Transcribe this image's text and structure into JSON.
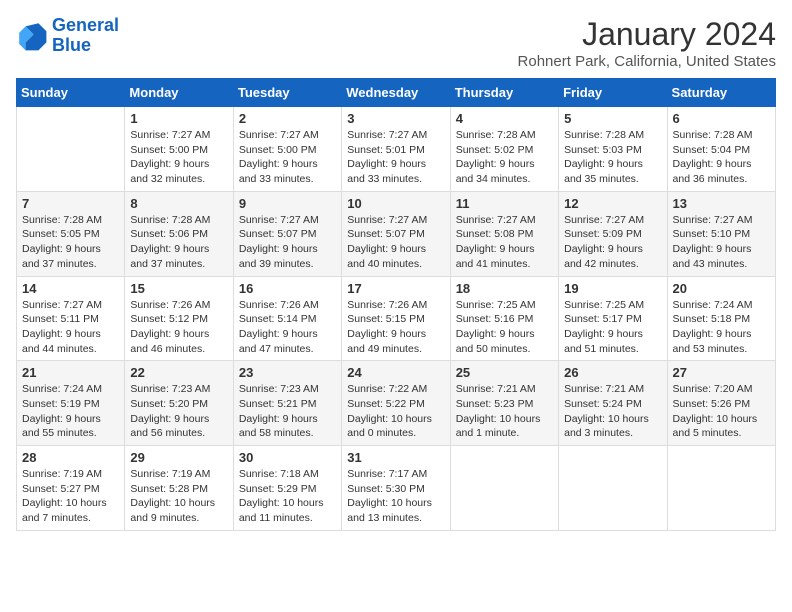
{
  "header": {
    "logo_line1": "General",
    "logo_line2": "Blue",
    "title": "January 2024",
    "subtitle": "Rohnert Park, California, United States"
  },
  "weekdays": [
    "Sunday",
    "Monday",
    "Tuesday",
    "Wednesday",
    "Thursday",
    "Friday",
    "Saturday"
  ],
  "weeks": [
    [
      {
        "day": "",
        "sunrise": "",
        "sunset": "",
        "daylight": ""
      },
      {
        "day": "1",
        "sunrise": "Sunrise: 7:27 AM",
        "sunset": "Sunset: 5:00 PM",
        "daylight": "Daylight: 9 hours and 32 minutes."
      },
      {
        "day": "2",
        "sunrise": "Sunrise: 7:27 AM",
        "sunset": "Sunset: 5:00 PM",
        "daylight": "Daylight: 9 hours and 33 minutes."
      },
      {
        "day": "3",
        "sunrise": "Sunrise: 7:27 AM",
        "sunset": "Sunset: 5:01 PM",
        "daylight": "Daylight: 9 hours and 33 minutes."
      },
      {
        "day": "4",
        "sunrise": "Sunrise: 7:28 AM",
        "sunset": "Sunset: 5:02 PM",
        "daylight": "Daylight: 9 hours and 34 minutes."
      },
      {
        "day": "5",
        "sunrise": "Sunrise: 7:28 AM",
        "sunset": "Sunset: 5:03 PM",
        "daylight": "Daylight: 9 hours and 35 minutes."
      },
      {
        "day": "6",
        "sunrise": "Sunrise: 7:28 AM",
        "sunset": "Sunset: 5:04 PM",
        "daylight": "Daylight: 9 hours and 36 minutes."
      }
    ],
    [
      {
        "day": "7",
        "sunrise": "Sunrise: 7:28 AM",
        "sunset": "Sunset: 5:05 PM",
        "daylight": "Daylight: 9 hours and 37 minutes."
      },
      {
        "day": "8",
        "sunrise": "Sunrise: 7:28 AM",
        "sunset": "Sunset: 5:06 PM",
        "daylight": "Daylight: 9 hours and 37 minutes."
      },
      {
        "day": "9",
        "sunrise": "Sunrise: 7:27 AM",
        "sunset": "Sunset: 5:07 PM",
        "daylight": "Daylight: 9 hours and 39 minutes."
      },
      {
        "day": "10",
        "sunrise": "Sunrise: 7:27 AM",
        "sunset": "Sunset: 5:07 PM",
        "daylight": "Daylight: 9 hours and 40 minutes."
      },
      {
        "day": "11",
        "sunrise": "Sunrise: 7:27 AM",
        "sunset": "Sunset: 5:08 PM",
        "daylight": "Daylight: 9 hours and 41 minutes."
      },
      {
        "day": "12",
        "sunrise": "Sunrise: 7:27 AM",
        "sunset": "Sunset: 5:09 PM",
        "daylight": "Daylight: 9 hours and 42 minutes."
      },
      {
        "day": "13",
        "sunrise": "Sunrise: 7:27 AM",
        "sunset": "Sunset: 5:10 PM",
        "daylight": "Daylight: 9 hours and 43 minutes."
      }
    ],
    [
      {
        "day": "14",
        "sunrise": "Sunrise: 7:27 AM",
        "sunset": "Sunset: 5:11 PM",
        "daylight": "Daylight: 9 hours and 44 minutes."
      },
      {
        "day": "15",
        "sunrise": "Sunrise: 7:26 AM",
        "sunset": "Sunset: 5:12 PM",
        "daylight": "Daylight: 9 hours and 46 minutes."
      },
      {
        "day": "16",
        "sunrise": "Sunrise: 7:26 AM",
        "sunset": "Sunset: 5:14 PM",
        "daylight": "Daylight: 9 hours and 47 minutes."
      },
      {
        "day": "17",
        "sunrise": "Sunrise: 7:26 AM",
        "sunset": "Sunset: 5:15 PM",
        "daylight": "Daylight: 9 hours and 49 minutes."
      },
      {
        "day": "18",
        "sunrise": "Sunrise: 7:25 AM",
        "sunset": "Sunset: 5:16 PM",
        "daylight": "Daylight: 9 hours and 50 minutes."
      },
      {
        "day": "19",
        "sunrise": "Sunrise: 7:25 AM",
        "sunset": "Sunset: 5:17 PM",
        "daylight": "Daylight: 9 hours and 51 minutes."
      },
      {
        "day": "20",
        "sunrise": "Sunrise: 7:24 AM",
        "sunset": "Sunset: 5:18 PM",
        "daylight": "Daylight: 9 hours and 53 minutes."
      }
    ],
    [
      {
        "day": "21",
        "sunrise": "Sunrise: 7:24 AM",
        "sunset": "Sunset: 5:19 PM",
        "daylight": "Daylight: 9 hours and 55 minutes."
      },
      {
        "day": "22",
        "sunrise": "Sunrise: 7:23 AM",
        "sunset": "Sunset: 5:20 PM",
        "daylight": "Daylight: 9 hours and 56 minutes."
      },
      {
        "day": "23",
        "sunrise": "Sunrise: 7:23 AM",
        "sunset": "Sunset: 5:21 PM",
        "daylight": "Daylight: 9 hours and 58 minutes."
      },
      {
        "day": "24",
        "sunrise": "Sunrise: 7:22 AM",
        "sunset": "Sunset: 5:22 PM",
        "daylight": "Daylight: 10 hours and 0 minutes."
      },
      {
        "day": "25",
        "sunrise": "Sunrise: 7:21 AM",
        "sunset": "Sunset: 5:23 PM",
        "daylight": "Daylight: 10 hours and 1 minute."
      },
      {
        "day": "26",
        "sunrise": "Sunrise: 7:21 AM",
        "sunset": "Sunset: 5:24 PM",
        "daylight": "Daylight: 10 hours and 3 minutes."
      },
      {
        "day": "27",
        "sunrise": "Sunrise: 7:20 AM",
        "sunset": "Sunset: 5:26 PM",
        "daylight": "Daylight: 10 hours and 5 minutes."
      }
    ],
    [
      {
        "day": "28",
        "sunrise": "Sunrise: 7:19 AM",
        "sunset": "Sunset: 5:27 PM",
        "daylight": "Daylight: 10 hours and 7 minutes."
      },
      {
        "day": "29",
        "sunrise": "Sunrise: 7:19 AM",
        "sunset": "Sunset: 5:28 PM",
        "daylight": "Daylight: 10 hours and 9 minutes."
      },
      {
        "day": "30",
        "sunrise": "Sunrise: 7:18 AM",
        "sunset": "Sunset: 5:29 PM",
        "daylight": "Daylight: 10 hours and 11 minutes."
      },
      {
        "day": "31",
        "sunrise": "Sunrise: 7:17 AM",
        "sunset": "Sunset: 5:30 PM",
        "daylight": "Daylight: 10 hours and 13 minutes."
      },
      {
        "day": "",
        "sunrise": "",
        "sunset": "",
        "daylight": ""
      },
      {
        "day": "",
        "sunrise": "",
        "sunset": "",
        "daylight": ""
      },
      {
        "day": "",
        "sunrise": "",
        "sunset": "",
        "daylight": ""
      }
    ]
  ]
}
